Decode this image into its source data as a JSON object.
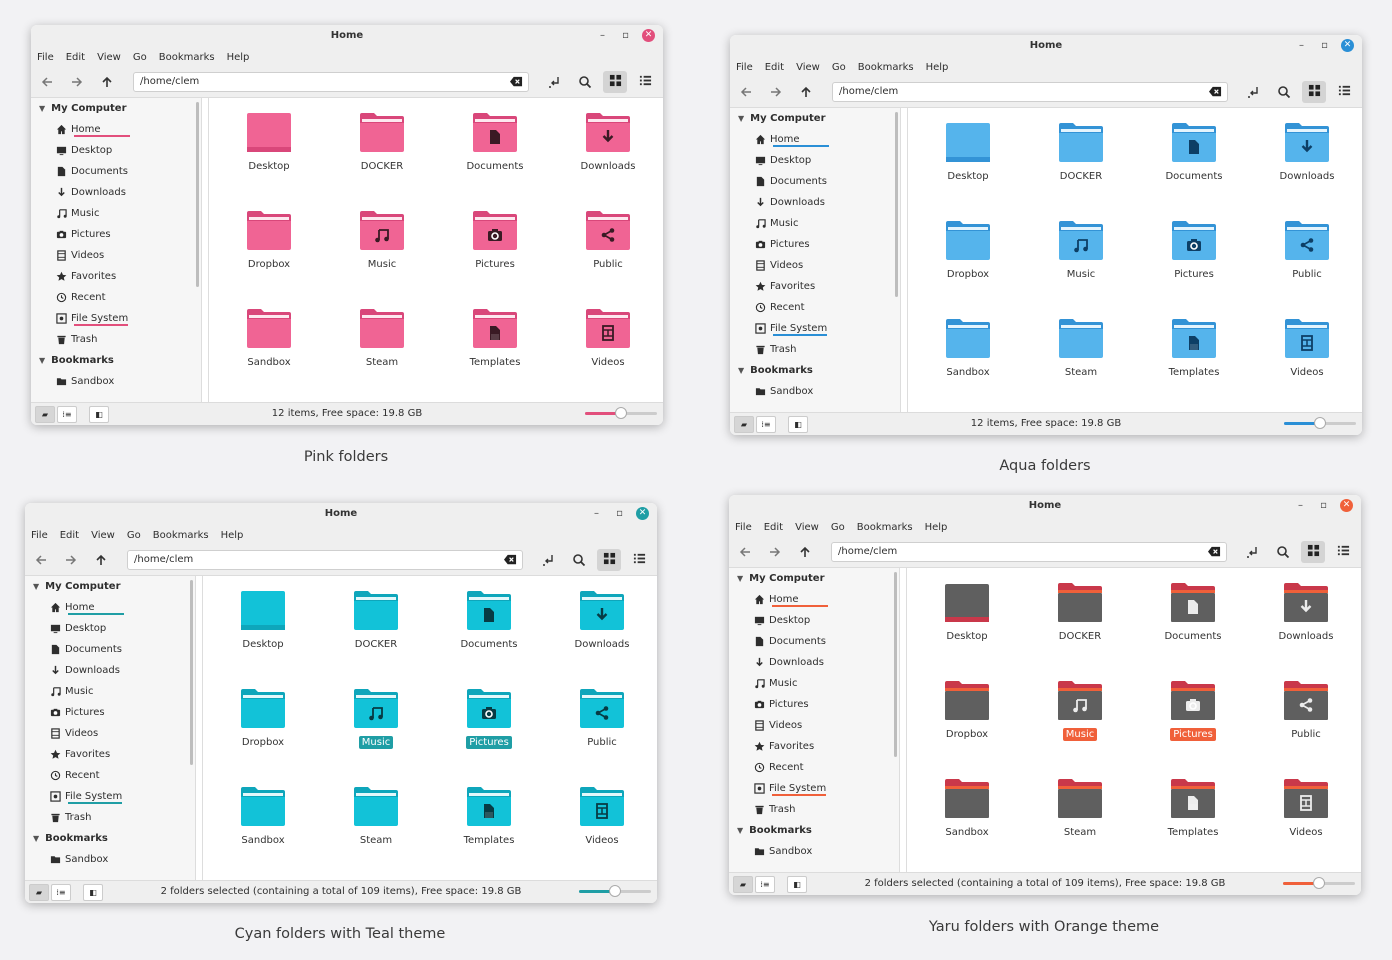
{
  "windows": [
    {
      "id": "pink",
      "title": "Home",
      "menu": [
        "File",
        "Edit",
        "View",
        "Go",
        "Bookmarks",
        "Help"
      ],
      "path": "/home/clem",
      "accent": "#e24f7c",
      "folder_body": "#f06494",
      "folder_tab": "#d9477a",
      "folder_stripe": "#fde8ef",
      "glyph_color": "#3a1a24",
      "style": "flat",
      "sidebar": {
        "section1": "My Computer",
        "items": [
          "Home",
          "Desktop",
          "Documents",
          "Downloads",
          "Music",
          "Pictures",
          "Videos",
          "Favorites",
          "Recent",
          "File System",
          "Trash"
        ],
        "section2": "Bookmarks",
        "bookmarks": [
          "Sandbox"
        ]
      },
      "files": [
        "Desktop",
        "DOCKER",
        "Documents",
        "Downloads",
        "Dropbox",
        "Music",
        "Pictures",
        "Public",
        "Sandbox",
        "Steam",
        "Templates",
        "Videos"
      ],
      "selected": [],
      "status": "12 items, Free space: 19.8 GB",
      "zoom": 0.5,
      "caption": "Pink folders"
    },
    {
      "id": "aqua",
      "title": "Home",
      "menu": [
        "File",
        "Edit",
        "View",
        "Go",
        "Bookmarks",
        "Help"
      ],
      "path": "/home/clem",
      "accent": "#2a8fd6",
      "folder_body": "#55b4ec",
      "folder_tab": "#3393d6",
      "folder_stripe": "#e4f4fd",
      "glyph_color": "#0d3f66",
      "style": "flat",
      "sidebar": {
        "section1": "My Computer",
        "items": [
          "Home",
          "Desktop",
          "Documents",
          "Downloads",
          "Music",
          "Pictures",
          "Videos",
          "Favorites",
          "Recent",
          "File System",
          "Trash"
        ],
        "section2": "Bookmarks",
        "bookmarks": [
          "Sandbox"
        ]
      },
      "files": [
        "Desktop",
        "DOCKER",
        "Documents",
        "Downloads",
        "Dropbox",
        "Music",
        "Pictures",
        "Public",
        "Sandbox",
        "Steam",
        "Templates",
        "Videos"
      ],
      "selected": [],
      "status": "12 items, Free space: 19.8 GB",
      "zoom": 0.5,
      "caption": "Aqua folders"
    },
    {
      "id": "cyan",
      "title": "Home",
      "menu": [
        "File",
        "Edit",
        "View",
        "Go",
        "Bookmarks",
        "Help"
      ],
      "path": "/home/clem",
      "accent": "#1f9ea5",
      "folder_body": "#12c2d8",
      "folder_tab": "#0ea6bb",
      "folder_stripe": "#e3f8fb",
      "glyph_color": "#073b44",
      "style": "flat",
      "sidebar": {
        "section1": "My Computer",
        "items": [
          "Home",
          "Desktop",
          "Documents",
          "Downloads",
          "Music",
          "Pictures",
          "Videos",
          "Favorites",
          "Recent",
          "File System",
          "Trash"
        ],
        "section2": "Bookmarks",
        "bookmarks": [
          "Sandbox"
        ]
      },
      "files": [
        "Desktop",
        "DOCKER",
        "Documents",
        "Downloads",
        "Dropbox",
        "Music",
        "Pictures",
        "Public",
        "Sandbox",
        "Steam",
        "Templates",
        "Videos"
      ],
      "selected": [
        "Music",
        "Pictures"
      ],
      "status": "2 folders selected (containing a total of 109 items), Free space: 19.8 GB",
      "zoom": 0.5,
      "caption": "Cyan folders with Teal theme"
    },
    {
      "id": "yaru",
      "title": "Home",
      "menu": [
        "File",
        "Edit",
        "View",
        "Go",
        "Bookmarks",
        "Help"
      ],
      "path": "/home/clem",
      "accent": "#f0603a",
      "folder_body": "#5f5f5f",
      "folder_tab": "#c9384a",
      "folder_stripe": "#f0603a",
      "glyph_color": "#ececec",
      "style": "yaru",
      "sidebar": {
        "section1": "My Computer",
        "items": [
          "Home",
          "Desktop",
          "Documents",
          "Downloads",
          "Music",
          "Pictures",
          "Videos",
          "Favorites",
          "Recent",
          "File System",
          "Trash"
        ],
        "section2": "Bookmarks",
        "bookmarks": [
          "Sandbox"
        ]
      },
      "files": [
        "Desktop",
        "DOCKER",
        "Documents",
        "Downloads",
        "Dropbox",
        "Music",
        "Pictures",
        "Public",
        "Sandbox",
        "Steam",
        "Templates",
        "Videos"
      ],
      "selected": [
        "Music",
        "Pictures"
      ],
      "status": "2 folders selected (containing a total of 109 items), Free space: 19.8 GB",
      "zoom": 0.5,
      "caption": "Yaru folders with Orange theme"
    }
  ]
}
